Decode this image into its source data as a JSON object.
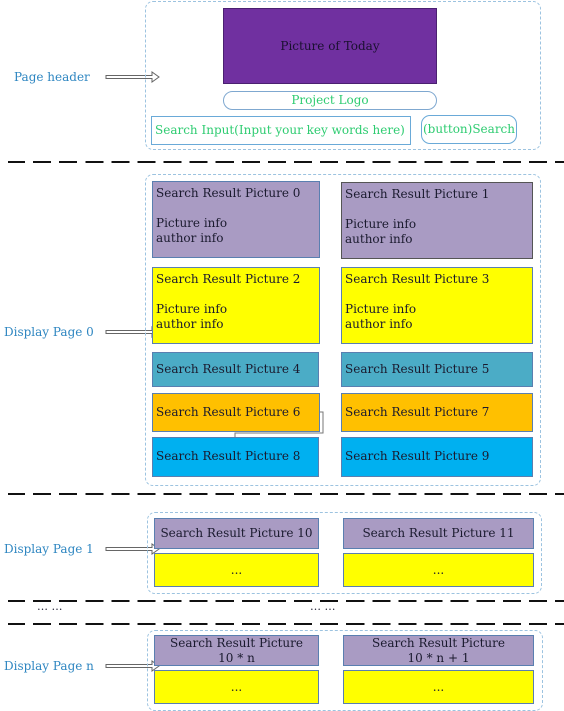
{
  "colors": {
    "today": "#7030a0",
    "purple": "#a99bc3",
    "yellow": "#ffff00",
    "teal": "#4bacc6",
    "orange": "#ffc000",
    "blue": "#00b0f0",
    "label": "#2e86c1",
    "green": "#2ecc71"
  },
  "header": {
    "label": "Page header",
    "picture": "Picture of Today",
    "logo": "Project Logo",
    "search_input": "Search Input(Input your key words here)",
    "search_button": "(button)Search"
  },
  "page0": {
    "label": "Display Page 0",
    "items": [
      {
        "title": "Search Result Picture 0",
        "info": "Picture info",
        "author": "author info"
      },
      {
        "title": "Search Result Picture 1",
        "info": "Picture info",
        "author": "author info"
      },
      {
        "title": "Search Result Picture 2",
        "info": "Picture info",
        "author": "author info"
      },
      {
        "title": "Search Result Picture 3",
        "info": "Picture info",
        "author": "author info"
      },
      {
        "title": "Search Result Picture 4"
      },
      {
        "title": "Search Result Picture 5"
      },
      {
        "title": "Search Result Picture 6"
      },
      {
        "title": "Search Result Picture 7"
      },
      {
        "title": "Search Result Picture 8"
      },
      {
        "title": "Search Result Picture 9"
      }
    ]
  },
  "page1": {
    "label": "Display Page 1",
    "items": [
      "Search Result Picture 10",
      "Search Result Picture 11"
    ],
    "more": "..."
  },
  "ellipsis": "… …",
  "pagen": {
    "label": "Display Page n",
    "items": [
      [
        "Search Result Picture",
        "10 * n"
      ],
      [
        "Search Result Picture",
        "10 * n + 1"
      ]
    ],
    "more": "..."
  }
}
